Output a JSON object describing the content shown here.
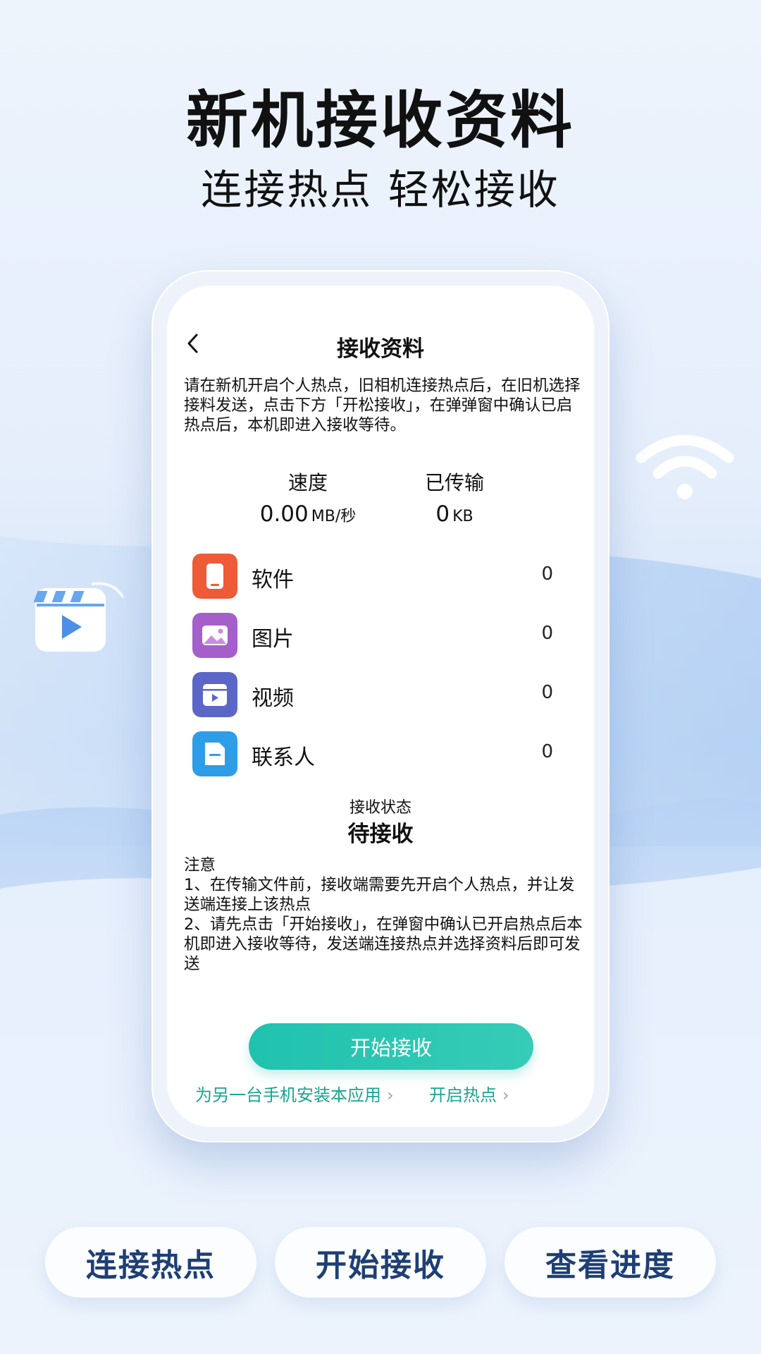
{
  "hero": {
    "title": "新机接收资料",
    "subtitle": "连接热点 轻松接收"
  },
  "decor": {
    "left_icon": "video-clip-icon",
    "right_icon": "wifi-icon"
  },
  "screen": {
    "back_icon": "chevron-left-icon",
    "title": "接收资料",
    "description": "请在新机开启个人热点，旧相机连接热点后，在旧机选择接料发送，点击下方「开松接收」，在弹弹窗中确认已启热点后，本机即进入接收等待。",
    "stats": {
      "speed_label": "速度",
      "speed_value": "0.00",
      "speed_unit": "MB/秒",
      "transferred_label": "已传输",
      "transferred_value": "0",
      "transferred_unit": "KB"
    },
    "categories": [
      {
        "label": "软件",
        "count": "0",
        "icon": "app-icon",
        "color": "#ee5b36"
      },
      {
        "label": "图片",
        "count": "0",
        "icon": "image-icon",
        "color": "#a45fcb"
      },
      {
        "label": "视频",
        "count": "0",
        "icon": "video-icon",
        "color": "#5c66c7"
      },
      {
        "label": "联系人",
        "count": "0",
        "icon": "contact-icon",
        "color": "#2e9de8"
      }
    ],
    "status_label": "接收状态",
    "status_value": "待接收",
    "notes": {
      "heading": "注意",
      "items": [
        "1、在传输文件前，接收端需要先开启个人热点，并让发送端连接上该热点",
        "2、请先点击「开始接收」，在弹窗中确认已开启热点后本机即进入接收等待，发送端连接热点并选择资料后即可发送"
      ]
    },
    "start_button": "开始接收",
    "link_install": "为另一台手机安装本应用",
    "link_hotspot": "开启热点",
    "accent_color": "#20c2ae"
  },
  "pills": [
    "连接热点",
    "开始接收",
    "查看进度"
  ]
}
